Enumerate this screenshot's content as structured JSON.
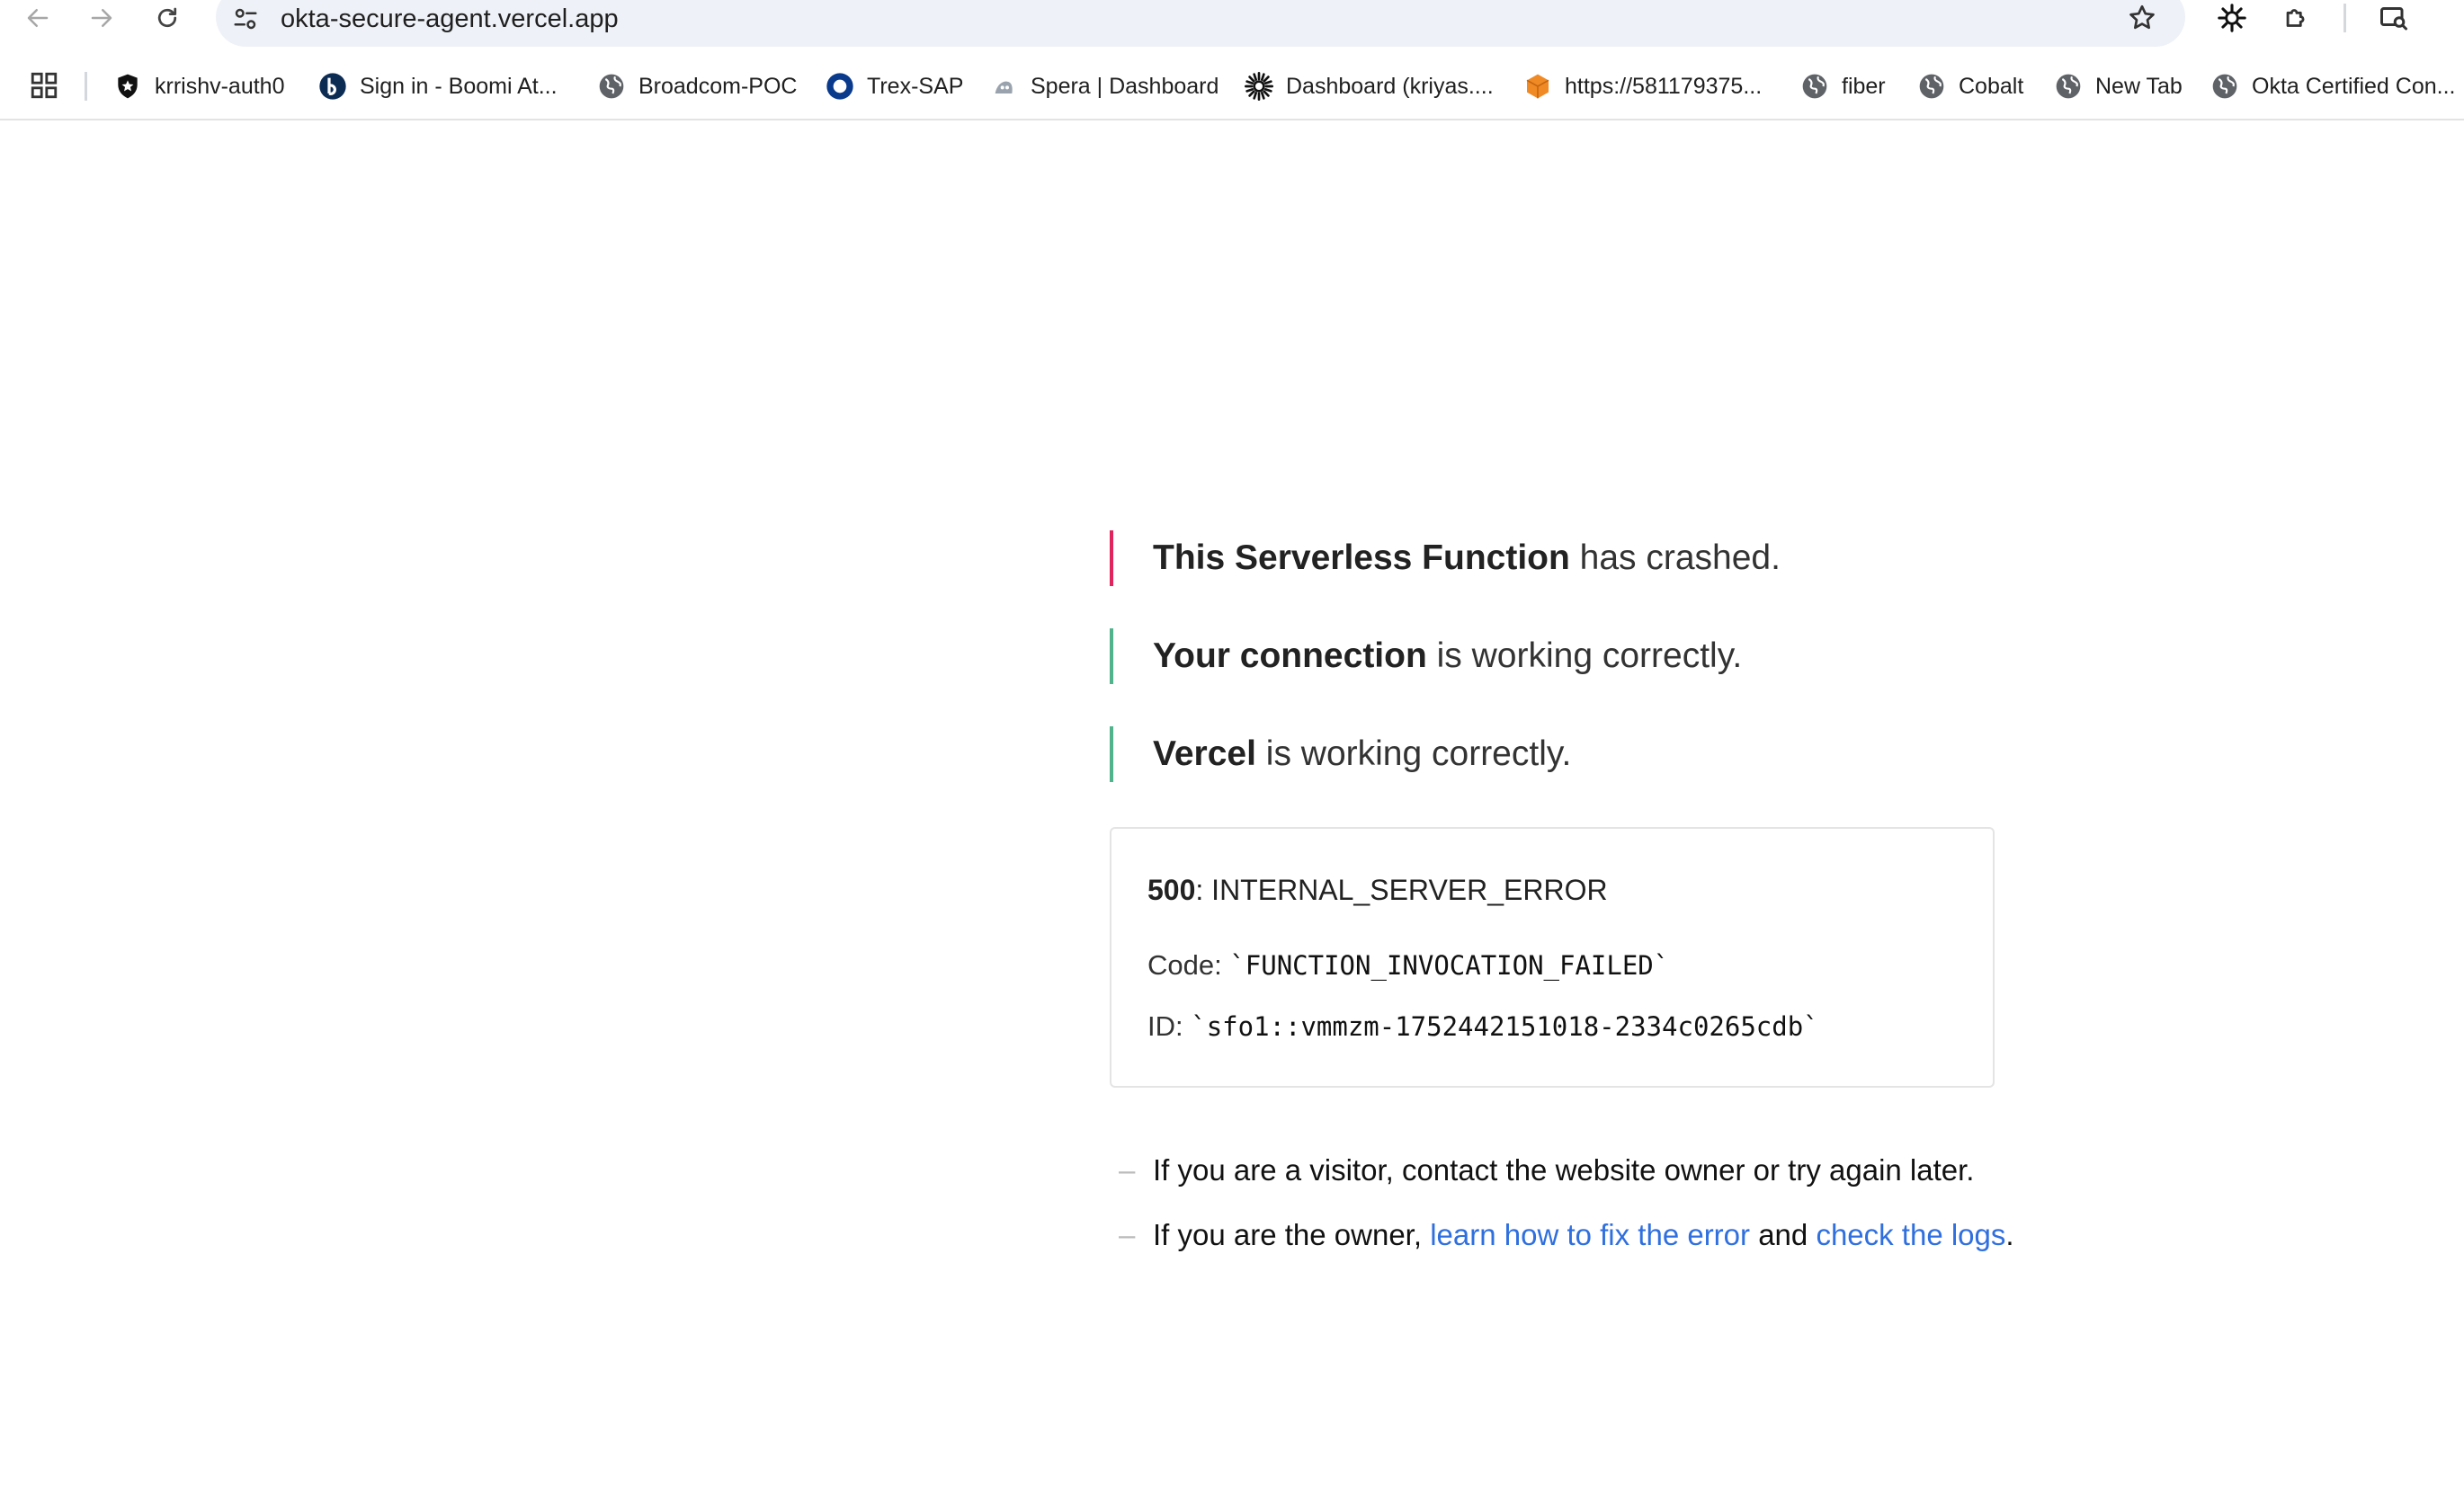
{
  "browser": {
    "url": "okta-secure-agent.vercel.app",
    "bookmarks": [
      {
        "label": "krrishv-auth0",
        "icon": "shield-icon"
      },
      {
        "label": "Sign in - Boomi At...",
        "icon": "boomi-b-icon"
      },
      {
        "label": "Broadcom-POC",
        "icon": "globe-icon"
      },
      {
        "label": "Trex-SAP",
        "icon": "ring-icon"
      },
      {
        "label": "Spera | Dashboard",
        "icon": "spera-icon"
      },
      {
        "label": "Dashboard (kriyas....",
        "icon": "okta-sun-icon"
      },
      {
        "label": "https://581179375...",
        "icon": "orange-cube-icon"
      },
      {
        "label": "fiber",
        "icon": "globe-icon"
      },
      {
        "label": "Cobalt",
        "icon": "globe-icon"
      },
      {
        "label": "New Tab",
        "icon": "globe-icon"
      },
      {
        "label": "Okta Certified Con...",
        "icon": "globe-icon"
      }
    ]
  },
  "page": {
    "statements": [
      {
        "bold": "This Serverless Function",
        "rest": " has crashed.",
        "bar_color": "#e0245e"
      },
      {
        "bold": "Your connection",
        "rest": " is working correctly.",
        "bar_color": "#50b38c"
      },
      {
        "bold": "Vercel",
        "rest": " is working correctly.",
        "bar_color": "#50b38c"
      }
    ],
    "error": {
      "status_code": "500",
      "status_text": ": INTERNAL_SERVER_ERROR",
      "code_label": "Code: ",
      "code_value": "`FUNCTION_INVOCATION_FAILED`",
      "id_label": "ID: ",
      "id_value": "`sfo1::vmmzm-1752442151018-2334c0265cdb`"
    },
    "help": {
      "dash": "–",
      "visitor": "If you are a visitor, contact the website owner or try again later.",
      "owner_prefix": "If you are the owner, ",
      "fix_link": "learn how to fix the error",
      "and": " and ",
      "logs_link": "check the logs",
      "period": "."
    }
  }
}
